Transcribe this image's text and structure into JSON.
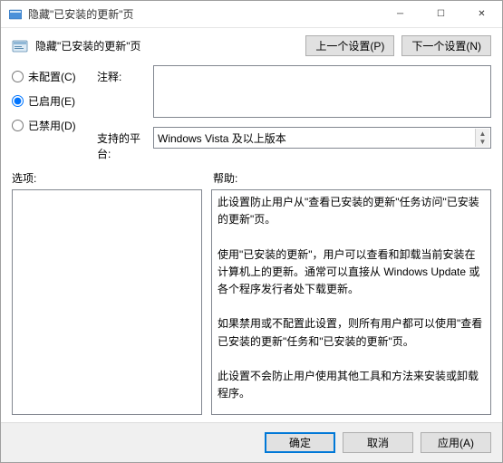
{
  "window": {
    "title": "隐藏\"已安装的更新\"页"
  },
  "header": {
    "title": "隐藏\"已安装的更新\"页",
    "prev_button": "上一个设置(P)",
    "next_button": "下一个设置(N)"
  },
  "config": {
    "radio_not_configured": "未配置(C)",
    "radio_enabled": "已启用(E)",
    "radio_disabled": "已禁用(D)",
    "selected": "enabled",
    "comment_label": "注释:",
    "comment_value": "",
    "platform_label": "支持的平台:",
    "platform_value": "Windows Vista 及以上版本"
  },
  "lower": {
    "options_label": "选项:",
    "help_label": "帮助:",
    "options_text": "",
    "help_text": "此设置防止用户从\"查看已安装的更新\"任务访问\"已安装的更新\"页。\n\n使用\"已安装的更新\"，用户可以查看和卸载当前安装在计算机上的更新。通常可以直接从 Windows Update 或各个程序发行者处下载更新。\n\n如果禁用或不配置此设置，则所有用户都可以使用\"查看已安装的更新\"任务和\"已安装的更新\"页。\n\n此设置不会防止用户使用其他工具和方法来安装或卸载程序。"
  },
  "footer": {
    "ok": "确定",
    "cancel": "取消",
    "apply": "应用(A)"
  }
}
